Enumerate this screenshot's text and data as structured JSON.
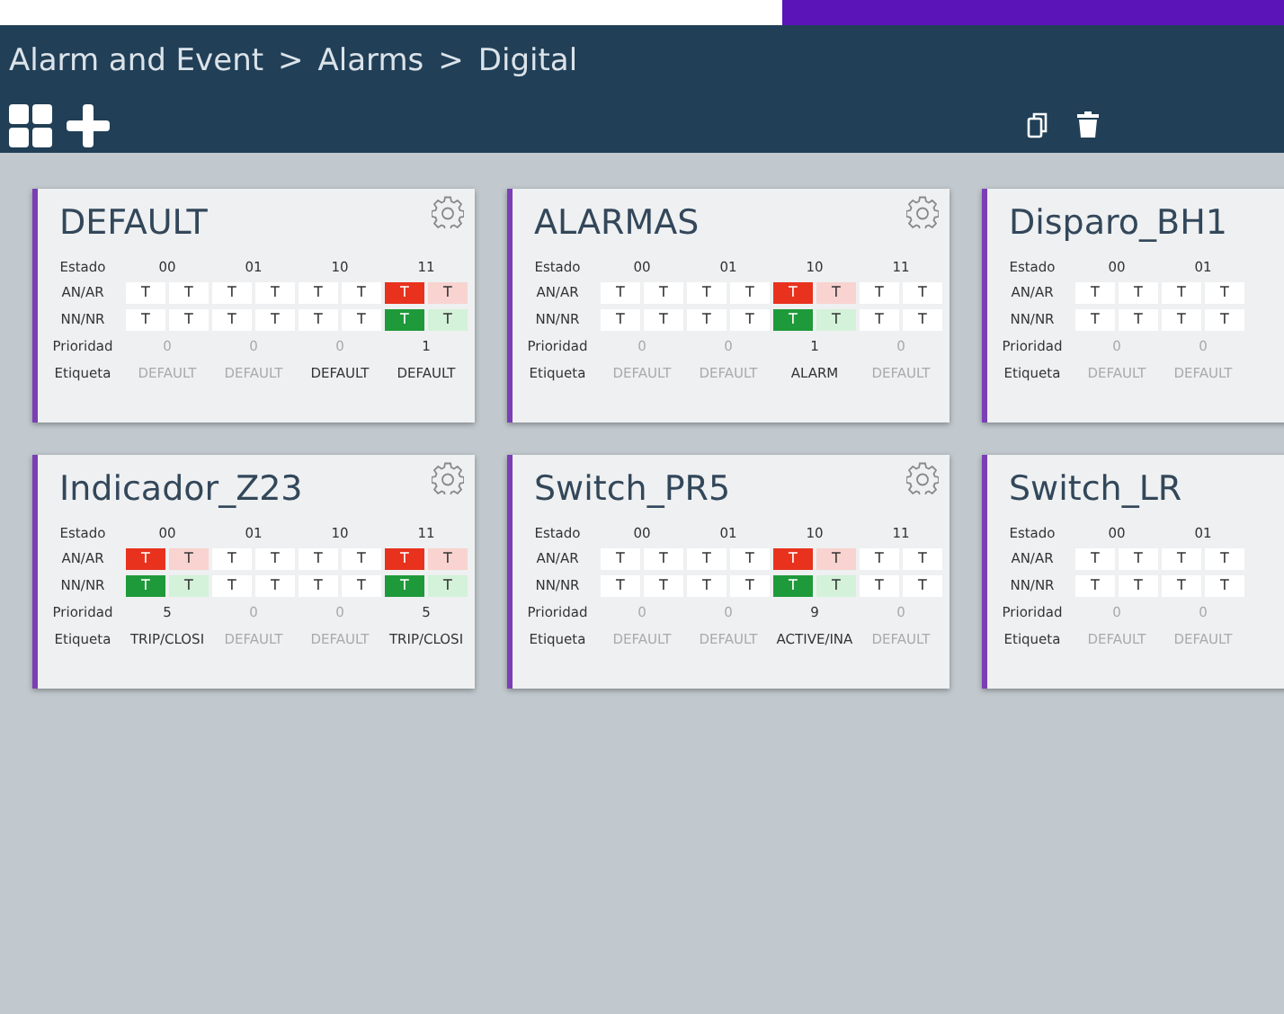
{
  "breadcrumb": {
    "items": [
      "Alarm and Event",
      "Alarms",
      "Digital"
    ],
    "separator": ">"
  },
  "cards": [
    {
      "title": "DEFAULT",
      "gear": true,
      "row_labels": [
        "Estado",
        "AN/AR",
        "NN/NR",
        "Prioridad",
        "Etiqueta"
      ],
      "states": [
        "00",
        "01",
        "10",
        "11"
      ],
      "an_ar": [
        {
          "text": "T",
          "kind": "plain"
        },
        {
          "text": "T",
          "kind": "plain"
        },
        {
          "text": "T",
          "kind": "plain"
        },
        {
          "text": "T",
          "kind": "plain"
        },
        {
          "text": "T",
          "kind": "plain"
        },
        {
          "text": "T",
          "kind": "plain"
        },
        {
          "text": "T",
          "kind": "alarm"
        },
        {
          "text": "T",
          "kind": "alarm-light"
        }
      ],
      "nn_nr": [
        {
          "text": "T",
          "kind": "plain"
        },
        {
          "text": "T",
          "kind": "plain"
        },
        {
          "text": "T",
          "kind": "plain"
        },
        {
          "text": "T",
          "kind": "plain"
        },
        {
          "text": "T",
          "kind": "plain"
        },
        {
          "text": "T",
          "kind": "plain"
        },
        {
          "text": "T",
          "kind": "normal"
        },
        {
          "text": "T",
          "kind": "normal-light"
        }
      ],
      "prioridad": [
        {
          "text": "0",
          "dim": true
        },
        {
          "text": "0",
          "dim": true
        },
        {
          "text": "0",
          "dim": true
        },
        {
          "text": "1",
          "dim": false
        }
      ],
      "etiqueta": [
        {
          "text": "DEFAULT",
          "dim": true
        },
        {
          "text": "DEFAULT",
          "dim": true
        },
        {
          "text": "DEFAULT",
          "dim": false
        },
        {
          "text": "DEFAULT",
          "dim": false
        }
      ]
    },
    {
      "title": "ALARMAS",
      "gear": true,
      "row_labels": [
        "Estado",
        "AN/AR",
        "NN/NR",
        "Prioridad",
        "Etiqueta"
      ],
      "states": [
        "00",
        "01",
        "10",
        "11"
      ],
      "an_ar": [
        {
          "text": "T",
          "kind": "plain"
        },
        {
          "text": "T",
          "kind": "plain"
        },
        {
          "text": "T",
          "kind": "plain"
        },
        {
          "text": "T",
          "kind": "plain"
        },
        {
          "text": "T",
          "kind": "alarm"
        },
        {
          "text": "T",
          "kind": "alarm-light"
        },
        {
          "text": "T",
          "kind": "plain"
        },
        {
          "text": "T",
          "kind": "plain"
        }
      ],
      "nn_nr": [
        {
          "text": "T",
          "kind": "plain"
        },
        {
          "text": "T",
          "kind": "plain"
        },
        {
          "text": "T",
          "kind": "plain"
        },
        {
          "text": "T",
          "kind": "plain"
        },
        {
          "text": "T",
          "kind": "normal"
        },
        {
          "text": "T",
          "kind": "normal-light"
        },
        {
          "text": "T",
          "kind": "plain"
        },
        {
          "text": "T",
          "kind": "plain"
        }
      ],
      "prioridad": [
        {
          "text": "0",
          "dim": true
        },
        {
          "text": "0",
          "dim": true
        },
        {
          "text": "1",
          "dim": false
        },
        {
          "text": "0",
          "dim": true
        }
      ],
      "etiqueta": [
        {
          "text": "DEFAULT",
          "dim": true
        },
        {
          "text": "DEFAULT",
          "dim": true
        },
        {
          "text": "ALARM",
          "dim": false
        },
        {
          "text": "DEFAULT",
          "dim": true
        }
      ]
    },
    {
      "title": "Disparo_BH1",
      "gear": false,
      "row_labels": [
        "Estado",
        "AN/AR",
        "NN/NR",
        "Prioridad",
        "Etiqueta"
      ],
      "states": [
        "00",
        "01"
      ],
      "an_ar": [
        {
          "text": "T",
          "kind": "plain"
        },
        {
          "text": "T",
          "kind": "plain"
        },
        {
          "text": "T",
          "kind": "plain"
        },
        {
          "text": "T",
          "kind": "plain"
        }
      ],
      "nn_nr": [
        {
          "text": "T",
          "kind": "plain"
        },
        {
          "text": "T",
          "kind": "plain"
        },
        {
          "text": "T",
          "kind": "plain"
        },
        {
          "text": "T",
          "kind": "plain"
        }
      ],
      "prioridad": [
        {
          "text": "0",
          "dim": true
        },
        {
          "text": "0",
          "dim": true
        }
      ],
      "etiqueta": [
        {
          "text": "DEFAULT",
          "dim": true
        },
        {
          "text": "DEFAULT",
          "dim": true
        }
      ]
    },
    {
      "title": "Indicador_Z23",
      "gear": true,
      "row_labels": [
        "Estado",
        "AN/AR",
        "NN/NR",
        "Prioridad",
        "Etiqueta"
      ],
      "states": [
        "00",
        "01",
        "10",
        "11"
      ],
      "an_ar": [
        {
          "text": "T",
          "kind": "alarm"
        },
        {
          "text": "T",
          "kind": "alarm-light"
        },
        {
          "text": "T",
          "kind": "plain"
        },
        {
          "text": "T",
          "kind": "plain"
        },
        {
          "text": "T",
          "kind": "plain"
        },
        {
          "text": "T",
          "kind": "plain"
        },
        {
          "text": "T",
          "kind": "alarm"
        },
        {
          "text": "T",
          "kind": "alarm-light"
        }
      ],
      "nn_nr": [
        {
          "text": "T",
          "kind": "normal"
        },
        {
          "text": "T",
          "kind": "normal-light"
        },
        {
          "text": "T",
          "kind": "plain"
        },
        {
          "text": "T",
          "kind": "plain"
        },
        {
          "text": "T",
          "kind": "plain"
        },
        {
          "text": "T",
          "kind": "plain"
        },
        {
          "text": "T",
          "kind": "normal"
        },
        {
          "text": "T",
          "kind": "normal-light"
        }
      ],
      "prioridad": [
        {
          "text": "5",
          "dim": false
        },
        {
          "text": "0",
          "dim": true
        },
        {
          "text": "0",
          "dim": true
        },
        {
          "text": "5",
          "dim": false
        }
      ],
      "etiqueta": [
        {
          "text": "TRIP/CLOSI",
          "dim": false
        },
        {
          "text": "DEFAULT",
          "dim": true
        },
        {
          "text": "DEFAULT",
          "dim": true
        },
        {
          "text": "TRIP/CLOSI",
          "dim": false
        }
      ]
    },
    {
      "title": "Switch_PR5",
      "gear": true,
      "row_labels": [
        "Estado",
        "AN/AR",
        "NN/NR",
        "Prioridad",
        "Etiqueta"
      ],
      "states": [
        "00",
        "01",
        "10",
        "11"
      ],
      "an_ar": [
        {
          "text": "T",
          "kind": "plain"
        },
        {
          "text": "T",
          "kind": "plain"
        },
        {
          "text": "T",
          "kind": "plain"
        },
        {
          "text": "T",
          "kind": "plain"
        },
        {
          "text": "T",
          "kind": "alarm"
        },
        {
          "text": "T",
          "kind": "alarm-light"
        },
        {
          "text": "T",
          "kind": "plain"
        },
        {
          "text": "T",
          "kind": "plain"
        }
      ],
      "nn_nr": [
        {
          "text": "T",
          "kind": "plain"
        },
        {
          "text": "T",
          "kind": "plain"
        },
        {
          "text": "T",
          "kind": "plain"
        },
        {
          "text": "T",
          "kind": "plain"
        },
        {
          "text": "T",
          "kind": "normal"
        },
        {
          "text": "T",
          "kind": "normal-light"
        },
        {
          "text": "T",
          "kind": "plain"
        },
        {
          "text": "T",
          "kind": "plain"
        }
      ],
      "prioridad": [
        {
          "text": "0",
          "dim": true
        },
        {
          "text": "0",
          "dim": true
        },
        {
          "text": "9",
          "dim": false
        },
        {
          "text": "0",
          "dim": true
        }
      ],
      "etiqueta": [
        {
          "text": "DEFAULT",
          "dim": true
        },
        {
          "text": "DEFAULT",
          "dim": true
        },
        {
          "text": "ACTIVE/INA",
          "dim": false
        },
        {
          "text": "DEFAULT",
          "dim": true
        }
      ]
    },
    {
      "title": "Switch_LR",
      "gear": false,
      "row_labels": [
        "Estado",
        "AN/AR",
        "NN/NR",
        "Prioridad",
        "Etiqueta"
      ],
      "states": [
        "00",
        "01"
      ],
      "an_ar": [
        {
          "text": "T",
          "kind": "plain"
        },
        {
          "text": "T",
          "kind": "plain"
        },
        {
          "text": "T",
          "kind": "plain"
        },
        {
          "text": "T",
          "kind": "plain"
        }
      ],
      "nn_nr": [
        {
          "text": "T",
          "kind": "plain"
        },
        {
          "text": "T",
          "kind": "plain"
        },
        {
          "text": "T",
          "kind": "plain"
        },
        {
          "text": "T",
          "kind": "plain"
        }
      ],
      "prioridad": [
        {
          "text": "0",
          "dim": true
        },
        {
          "text": "0",
          "dim": true
        }
      ],
      "etiqueta": [
        {
          "text": "DEFAULT",
          "dim": true
        },
        {
          "text": "DEFAULT",
          "dim": true
        }
      ]
    }
  ]
}
